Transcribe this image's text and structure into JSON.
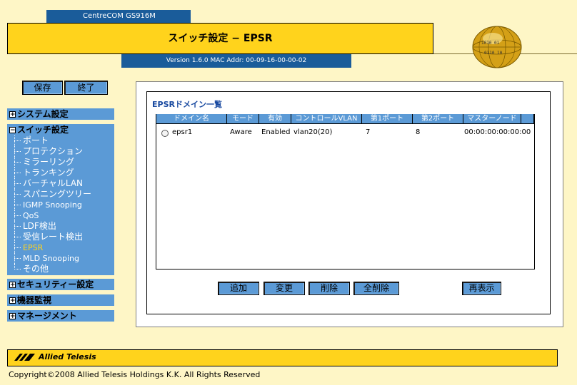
{
  "header": {
    "model": "CentreCOM GS916M",
    "title": "スイッチ設定 − EPSR",
    "version": "Version 1.6.0 MAC Addr: 00-09-16-00-00-02"
  },
  "side_buttons": {
    "save": "保存",
    "quit": "終了"
  },
  "nav": {
    "system": "システム設定",
    "switch": "スイッチ設定",
    "switch_items": [
      "ポート",
      "プロテクション",
      "ミラーリング",
      "トランキング",
      "バーチャルLAN",
      "スパニングツリー",
      "IGMP Snooping",
      "QoS",
      "LDF検出",
      "受信レート検出",
      "EPSR",
      "MLD Snooping",
      "その他"
    ],
    "security": "セキュリティー設定",
    "monitor": "機器監視",
    "management": "マネージメント",
    "active_item": "EPSR"
  },
  "main": {
    "section_title": "EPSRドメイン一覧",
    "columns": [
      "ドメイン名",
      "モード",
      "有効",
      "コントロールVLAN",
      "第1ポート",
      "第2ポート",
      "マスターノード"
    ],
    "rows": [
      {
        "domain": "epsr1",
        "mode": "Aware",
        "enabled": "Enabled",
        "control_vlan": "vlan20(20)",
        "port1": "7",
        "port2": "8",
        "master_node": "00:00:00:00:00:00"
      }
    ],
    "buttons": {
      "add": "追加",
      "modify": "変更",
      "delete": "削除",
      "delete_all": "全削除",
      "refresh": "再表示"
    }
  },
  "footer": {
    "logo_text": "Allied Telesis",
    "copyright": "Copyright©2008 Allied Telesis Holdings K.K. All Rights Reserved"
  },
  "colors": {
    "background": "#fef6c6",
    "header_yellow": "#ffd31c",
    "header_blue": "#1a5c9a",
    "nav_blue": "#5b9ad6",
    "active_item": "#ffd31c"
  }
}
